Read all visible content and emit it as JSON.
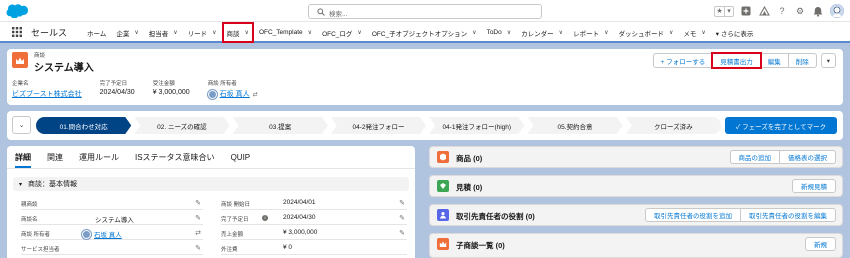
{
  "header": {
    "search_placeholder": "検索..."
  },
  "nav": {
    "app_name": "セールス",
    "items": [
      {
        "label": "ホーム",
        "chevron": false
      },
      {
        "label": "企業",
        "chevron": true
      },
      {
        "label": "担当者",
        "chevron": true
      },
      {
        "label": "リード",
        "chevron": true
      },
      {
        "label": "商談",
        "chevron": true,
        "active": true
      },
      {
        "label": "OFC_Template",
        "chevron": true
      },
      {
        "label": "OFC_ログ",
        "chevron": true
      },
      {
        "label": "OFC_子オブジェクトオプション",
        "chevron": true
      },
      {
        "label": "ToDo",
        "chevron": true
      },
      {
        "label": "カレンダー",
        "chevron": true
      },
      {
        "label": "レポート",
        "chevron": true
      },
      {
        "label": "ダッシュボード",
        "chevron": true
      },
      {
        "label": "メモ",
        "chevron": true
      },
      {
        "label": "▾ さらに表示",
        "chevron": false
      }
    ]
  },
  "record": {
    "object_label": "商談",
    "title": "システム導入",
    "actions": {
      "follow": "+ フォローする",
      "quote_output": "見積書出力",
      "edit": "編集",
      "delete": "削除"
    },
    "highlights": [
      {
        "label": "企業名",
        "value": "ビズブースト株式会社",
        "link": true
      },
      {
        "label": "完了予定日",
        "value": "2024/04/30",
        "link": false
      },
      {
        "label": "受注金額",
        "value": "¥ 3,000,000",
        "link": false
      },
      {
        "label": "商談 所有者",
        "value": "石坂 真人",
        "link": true
      }
    ]
  },
  "path": {
    "stages": [
      "01.問合わせ対応",
      "02. ニーズの確認",
      "03.提案",
      "04-2発注フォロー",
      "04-1発注フォロー(high)",
      "05.契約合意",
      "クローズ済み"
    ],
    "current_index": 0,
    "complete_button": "✓ フェーズを完了としてマーク"
  },
  "detail": {
    "tabs": [
      "詳細",
      "関連",
      "運用ルール",
      "ISステータス意味合い",
      "QUIP"
    ],
    "active_tab": 0,
    "section_title": "商談：基本情報",
    "left_fields": [
      {
        "label": "親商談",
        "value": ""
      },
      {
        "label": "商談名",
        "value": "システム導入"
      },
      {
        "label": "商談 所有者",
        "value": "石坂 真人"
      },
      {
        "label": "サービス担当者",
        "value": ""
      }
    ],
    "right_fields": [
      {
        "label": "商談 開始日",
        "value": "2024/04/01"
      },
      {
        "label": "完了予定日",
        "value": "2024/04/30"
      },
      {
        "label": "売上金額",
        "value": "¥ 3,000,000"
      },
      {
        "label": "外注費",
        "value": "¥ 0"
      }
    ]
  },
  "related": [
    {
      "title": "商品 (0)",
      "icon": "product-icon",
      "color": "#ef6e3a",
      "buttons": [
        "商品の追加",
        "価格表の選択"
      ]
    },
    {
      "title": "見積 (0)",
      "icon": "quote-icon",
      "color": "#3ba755",
      "buttons": [
        "新規見積"
      ]
    },
    {
      "title": "取引先責任者の役割 (0)",
      "icon": "contact-role-icon",
      "color": "#5867e8",
      "buttons": [
        "取引先責任者の役割を追加",
        "取引先責任者の役割を編集"
      ]
    },
    {
      "title": "子商談一覧 (0)",
      "icon": "opportunity-icon",
      "color": "#ef6e3a",
      "buttons": [
        "新規"
      ]
    }
  ],
  "colors": {
    "accent": "#0176d3",
    "path_current": "#014486",
    "highlight_outline": "#d9001b"
  }
}
